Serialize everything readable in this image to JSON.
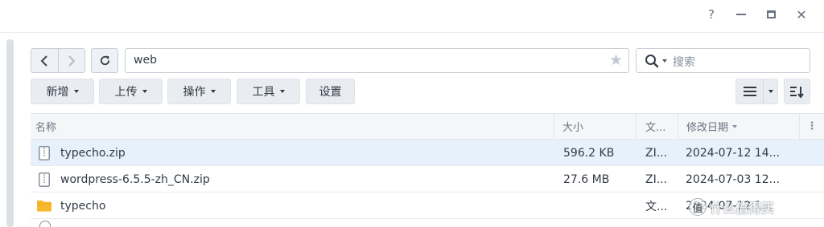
{
  "window": {
    "help_label": "?",
    "close_label": "✕"
  },
  "nav": {
    "back_icon": "chevron-left-icon",
    "forward_icon": "chevron-right-icon",
    "refresh_icon": "refresh-icon"
  },
  "path": {
    "value": "web",
    "favorite_icon": "star-icon"
  },
  "search": {
    "placeholder": "搜索",
    "icon": "search-icon"
  },
  "toolbar": {
    "create_label": "新增",
    "upload_label": "上传",
    "action_label": "操作",
    "tools_label": "工具",
    "settings_label": "设置",
    "view_icon": "list-view-icon",
    "sort_icon": "sort-icon"
  },
  "table": {
    "columns": {
      "name": "名称",
      "size": "大小",
      "type": "文...",
      "modified": "修改日期",
      "menu": "⋮"
    },
    "rows": [
      {
        "name": "typecho.zip",
        "size": "596.2 KB",
        "type": "ZI...",
        "modified": "2024-07-12 14...",
        "icon": "zip-file-icon",
        "selected": true
      },
      {
        "name": "wordpress-6.5.5-zh_CN.zip",
        "size": "27.6 MB",
        "type": "ZI...",
        "modified": "2024-07-03 12...",
        "icon": "zip-file-icon",
        "selected": false
      },
      {
        "name": "typecho",
        "size": "",
        "type": "文...",
        "modified": "2024-07-12 1...",
        "icon": "folder-icon",
        "selected": false
      }
    ]
  },
  "watermark": {
    "badge": "值",
    "text": "什么值得买"
  },
  "colors": {
    "selected_row": "#e6f1fc",
    "folder": "#f7b82d",
    "button_bg": "#e9ecf0"
  }
}
